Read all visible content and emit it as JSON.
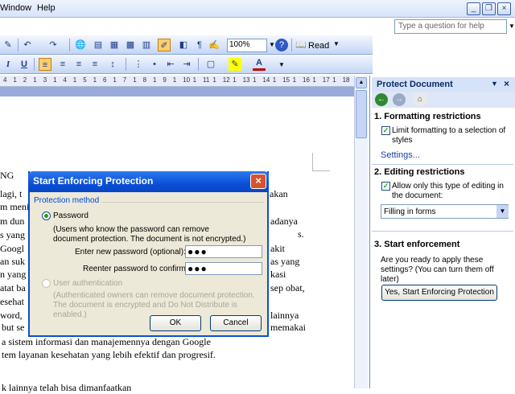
{
  "menubar": {
    "window": "Window",
    "help": "Help"
  },
  "ask_box": {
    "placeholder": "Type a question for help"
  },
  "window_controls": {
    "minimize": "_",
    "restore": "❐",
    "close": "×"
  },
  "toolbar": {
    "zoom": "100%",
    "read": "Read",
    "font_color_icon": "A",
    "bold": "B",
    "italic": "I",
    "underline": "U"
  },
  "ruler": {
    "marks": [
      "4",
      "1",
      "2",
      "1",
      "3",
      "1",
      "4",
      "1",
      "5",
      "1",
      "6",
      "1",
      "7",
      "1",
      "8",
      "1",
      "9",
      "1",
      "10",
      "1",
      "11",
      "1",
      "12",
      "1",
      "13",
      "1",
      "14",
      "1",
      "15",
      "1",
      "16",
      "1",
      "17",
      "1",
      "18"
    ]
  },
  "document": {
    "lines": [
      "NG",
      " lagi, t",
      "m menin",
      "m dun",
      "s yang",
      "Googl",
      "an suk",
      "n yang",
      "atat ba",
      "esehat",
      "word, ",
      "but se",
      "a sistem informasi dan manajemennya dengan Google",
      "tem layanan kesehatan yang lebih efektif dan progresif.",
      "k lainnya telah bisa dimanfaatkan"
    ],
    "right_fragments": [
      "akan",
      "adanya",
      "s.",
      "akit",
      "as yang",
      "kasi",
      "sep obat,",
      "lainnya",
      "memakai"
    ]
  },
  "taskpane": {
    "title": "Protect Document",
    "section1": "1. Formatting restrictions",
    "limit_label": "Limit formatting to a selection of styles",
    "settings": "Settings...",
    "section2": "2. Editing restrictions",
    "allow_label": "Allow only this type of editing in the document:",
    "editing_type": "Filling in forms",
    "section3": "3. Start enforcement",
    "ready_text": "Are you ready to apply these settings? (You can turn them off later)",
    "enforce_button": "Yes, Start Enforcing Protection"
  },
  "dialog": {
    "title": "Start Enforcing Protection",
    "group_label": "Protection method",
    "password_option": "Password",
    "password_note": "(Users who know the password can remove document protection. The document is not encrypted.)",
    "enter_label": "Enter new password (optional):",
    "enter_value": "●●●",
    "reenter_label": "Reenter password to confirm:",
    "reenter_value": "●●●",
    "user_auth_option": "User authentication",
    "user_auth_note": "(Authenticated owners can remove document protection. The document is encrypted and Do Not Distribute is enabled.)",
    "ok": "OK",
    "cancel": "Cancel"
  }
}
